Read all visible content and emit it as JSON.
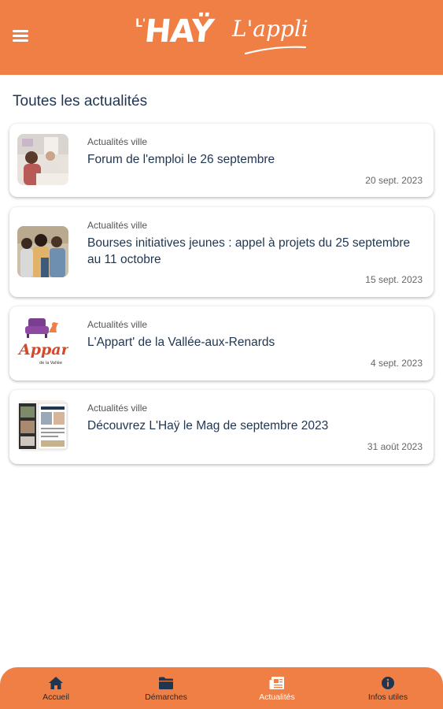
{
  "header": {
    "logo_prefix": "L'",
    "logo_main": "HAŸ",
    "logo_suffix": "L'appli",
    "accent_color": "#ef7f45",
    "menu_icon": "hamburger-menu-icon"
  },
  "section": {
    "title": "Toutes les actualités"
  },
  "news": [
    {
      "category": "Actualités ville",
      "title": "Forum de l'emploi le 26 septembre",
      "date": "20 sept. 2023"
    },
    {
      "category": "Actualités ville",
      "title": "Bourses initiatives jeunes : appel à projets du 25 septembre au 11 octobre",
      "date": "15 sept. 2023"
    },
    {
      "category": "Actualités ville",
      "title": "L'Appart' de la Vallée-aux-Renards",
      "date": "4 sept. 2023",
      "thumb_text": "Appart",
      "thumb_subtext": "de la Vallée"
    },
    {
      "category": "Actualités ville",
      "title": "Découvrez L'Haÿ le Mag de septembre 2023",
      "date": "31 août 2023"
    }
  ],
  "bottom_nav": {
    "items": [
      {
        "label": "Accueil",
        "icon": "home-icon",
        "active": false
      },
      {
        "label": "Démarches",
        "icon": "folder-icon",
        "active": false
      },
      {
        "label": "Actualités",
        "icon": "newspaper-icon",
        "active": true
      },
      {
        "label": "Infos utiles",
        "icon": "info-icon",
        "active": false
      }
    ]
  }
}
